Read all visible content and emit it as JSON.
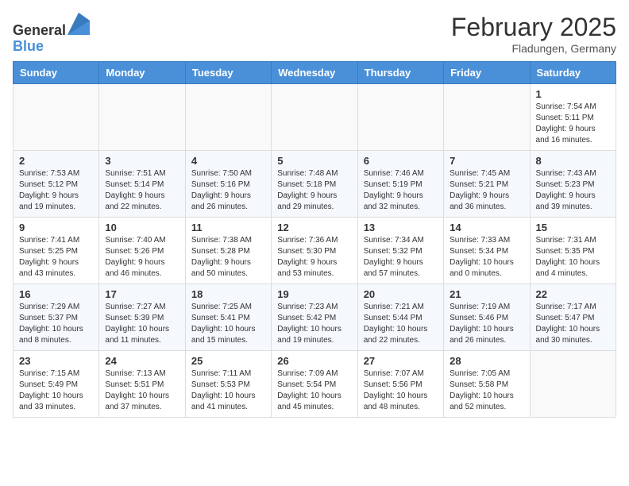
{
  "header": {
    "logo_line1": "General",
    "logo_line2": "Blue",
    "month_title": "February 2025",
    "location": "Fladungen, Germany"
  },
  "weekdays": [
    "Sunday",
    "Monday",
    "Tuesday",
    "Wednesday",
    "Thursday",
    "Friday",
    "Saturday"
  ],
  "weeks": [
    [
      {
        "day": "",
        "info": ""
      },
      {
        "day": "",
        "info": ""
      },
      {
        "day": "",
        "info": ""
      },
      {
        "day": "",
        "info": ""
      },
      {
        "day": "",
        "info": ""
      },
      {
        "day": "",
        "info": ""
      },
      {
        "day": "1",
        "info": "Sunrise: 7:54 AM\nSunset: 5:11 PM\nDaylight: 9 hours\nand 16 minutes."
      }
    ],
    [
      {
        "day": "2",
        "info": "Sunrise: 7:53 AM\nSunset: 5:12 PM\nDaylight: 9 hours\nand 19 minutes."
      },
      {
        "day": "3",
        "info": "Sunrise: 7:51 AM\nSunset: 5:14 PM\nDaylight: 9 hours\nand 22 minutes."
      },
      {
        "day": "4",
        "info": "Sunrise: 7:50 AM\nSunset: 5:16 PM\nDaylight: 9 hours\nand 26 minutes."
      },
      {
        "day": "5",
        "info": "Sunrise: 7:48 AM\nSunset: 5:18 PM\nDaylight: 9 hours\nand 29 minutes."
      },
      {
        "day": "6",
        "info": "Sunrise: 7:46 AM\nSunset: 5:19 PM\nDaylight: 9 hours\nand 32 minutes."
      },
      {
        "day": "7",
        "info": "Sunrise: 7:45 AM\nSunset: 5:21 PM\nDaylight: 9 hours\nand 36 minutes."
      },
      {
        "day": "8",
        "info": "Sunrise: 7:43 AM\nSunset: 5:23 PM\nDaylight: 9 hours\nand 39 minutes."
      }
    ],
    [
      {
        "day": "9",
        "info": "Sunrise: 7:41 AM\nSunset: 5:25 PM\nDaylight: 9 hours\nand 43 minutes."
      },
      {
        "day": "10",
        "info": "Sunrise: 7:40 AM\nSunset: 5:26 PM\nDaylight: 9 hours\nand 46 minutes."
      },
      {
        "day": "11",
        "info": "Sunrise: 7:38 AM\nSunset: 5:28 PM\nDaylight: 9 hours\nand 50 minutes."
      },
      {
        "day": "12",
        "info": "Sunrise: 7:36 AM\nSunset: 5:30 PM\nDaylight: 9 hours\nand 53 minutes."
      },
      {
        "day": "13",
        "info": "Sunrise: 7:34 AM\nSunset: 5:32 PM\nDaylight: 9 hours\nand 57 minutes."
      },
      {
        "day": "14",
        "info": "Sunrise: 7:33 AM\nSunset: 5:34 PM\nDaylight: 10 hours\nand 0 minutes."
      },
      {
        "day": "15",
        "info": "Sunrise: 7:31 AM\nSunset: 5:35 PM\nDaylight: 10 hours\nand 4 minutes."
      }
    ],
    [
      {
        "day": "16",
        "info": "Sunrise: 7:29 AM\nSunset: 5:37 PM\nDaylight: 10 hours\nand 8 minutes."
      },
      {
        "day": "17",
        "info": "Sunrise: 7:27 AM\nSunset: 5:39 PM\nDaylight: 10 hours\nand 11 minutes."
      },
      {
        "day": "18",
        "info": "Sunrise: 7:25 AM\nSunset: 5:41 PM\nDaylight: 10 hours\nand 15 minutes."
      },
      {
        "day": "19",
        "info": "Sunrise: 7:23 AM\nSunset: 5:42 PM\nDaylight: 10 hours\nand 19 minutes."
      },
      {
        "day": "20",
        "info": "Sunrise: 7:21 AM\nSunset: 5:44 PM\nDaylight: 10 hours\nand 22 minutes."
      },
      {
        "day": "21",
        "info": "Sunrise: 7:19 AM\nSunset: 5:46 PM\nDaylight: 10 hours\nand 26 minutes."
      },
      {
        "day": "22",
        "info": "Sunrise: 7:17 AM\nSunset: 5:47 PM\nDaylight: 10 hours\nand 30 minutes."
      }
    ],
    [
      {
        "day": "23",
        "info": "Sunrise: 7:15 AM\nSunset: 5:49 PM\nDaylight: 10 hours\nand 33 minutes."
      },
      {
        "day": "24",
        "info": "Sunrise: 7:13 AM\nSunset: 5:51 PM\nDaylight: 10 hours\nand 37 minutes."
      },
      {
        "day": "25",
        "info": "Sunrise: 7:11 AM\nSunset: 5:53 PM\nDaylight: 10 hours\nand 41 minutes."
      },
      {
        "day": "26",
        "info": "Sunrise: 7:09 AM\nSunset: 5:54 PM\nDaylight: 10 hours\nand 45 minutes."
      },
      {
        "day": "27",
        "info": "Sunrise: 7:07 AM\nSunset: 5:56 PM\nDaylight: 10 hours\nand 48 minutes."
      },
      {
        "day": "28",
        "info": "Sunrise: 7:05 AM\nSunset: 5:58 PM\nDaylight: 10 hours\nand 52 minutes."
      },
      {
        "day": "",
        "info": ""
      }
    ]
  ]
}
